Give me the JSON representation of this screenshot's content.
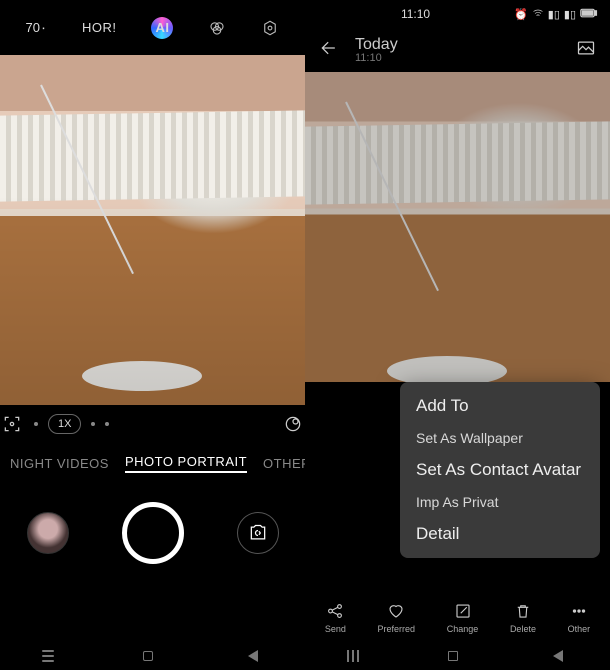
{
  "left": {
    "top": {
      "label1": "70۰",
      "label2": "HOR!",
      "ai_label": "AI"
    },
    "zoom": {
      "value": "1X"
    },
    "modes": {
      "m1": "NIGHT VIDEOS",
      "m2": "PHOTO PORTRAIT",
      "m3": "OTHER"
    }
  },
  "right": {
    "status": {
      "time": "11:10"
    },
    "header": {
      "title": "Today",
      "subtitle": "11:10"
    },
    "menu": {
      "add_to": "Add To",
      "wallpaper": "Set As Wallpaper",
      "avatar": "Set As Contact Avatar",
      "private": "Imp As Privat",
      "detail": "Detail"
    },
    "actions": {
      "send": "Send",
      "preferred": "Preferred",
      "change": "Change",
      "delete": "Delete",
      "other": "Other"
    }
  }
}
